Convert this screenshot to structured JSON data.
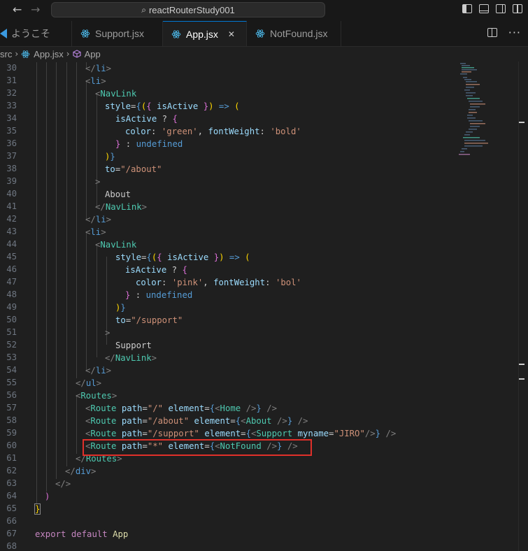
{
  "titlebar": {
    "back_icon": "arrow-left-icon",
    "forward_icon": "arrow-right-icon",
    "search_text": "reactRouterStudy001"
  },
  "tabs": [
    {
      "label": "ようこそ",
      "icon": "vscode-icon"
    },
    {
      "label": "Support.jsx",
      "icon": "react-icon"
    },
    {
      "label": "App.jsx",
      "icon": "react-icon",
      "active": true
    },
    {
      "label": "NotFound.jsx",
      "icon": "react-icon"
    }
  ],
  "breadcrumb": {
    "items": [
      "src",
      "App.jsx",
      "App"
    ]
  },
  "editor": {
    "line_numbers": [
      "30",
      "31",
      "32",
      "33",
      "34",
      "35",
      "36",
      "37",
      "38",
      "39",
      "40",
      "41",
      "42",
      "43",
      "44",
      "45",
      "46",
      "47",
      "48",
      "49",
      "50",
      "51",
      "52",
      "53",
      "54",
      "55",
      "56",
      "57",
      "58",
      "59",
      "60",
      "61",
      "62",
      "63",
      "64",
      "65",
      "66",
      "67",
      "68"
    ],
    "lines": [
      "</li>",
      "<li>",
      "<NavLink",
      "style={({ isActive }) => (",
      "isActive ? {",
      "color: 'green', fontWeight: 'bold'",
      "} : undefined",
      ")}",
      "to=\"/about\"",
      ">",
      "About",
      "</NavLink>",
      "</li>",
      "<li>",
      "<NavLink",
      "style={({ isActive }) => (",
      "isActive ? {",
      "color: 'pink', fontWeight: 'bol'",
      "} : undefined",
      ")}",
      "to=\"/support\"",
      ">",
      "Support",
      "</NavLink>",
      "</li>",
      "</ul>",
      "<Routes>",
      "<Route path=\"/\" element={<Home />} />",
      "<Route path=\"/about\" element={<About />} />",
      "<Route path=\"/support\" element={<Support myname=\"JIRO\"/>} />",
      "<Route path=\"*\" element={<NotFound />} />",
      "</Routes>",
      "</div>",
      "</>",
      ")",
      "}",
      "",
      "export default App",
      ""
    ]
  },
  "colors": {
    "background": "#1f1f1f",
    "highlight_box": "#e0302a",
    "accent": "#0078d4"
  }
}
